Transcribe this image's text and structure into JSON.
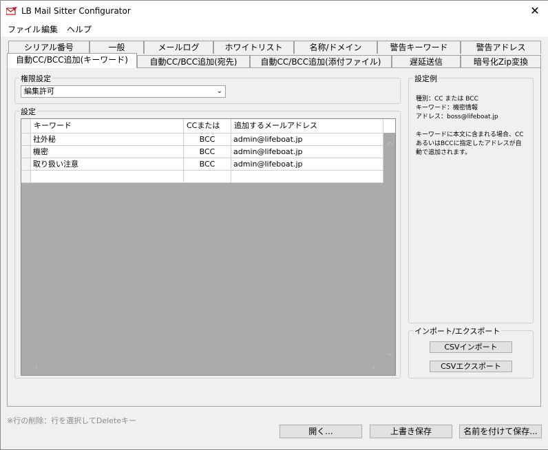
{
  "window": {
    "title": "LB Mail Sitter Configurator"
  },
  "menu": [
    "ファイル",
    "編集",
    "ヘルプ"
  ],
  "tabs_row1": [
    "シリアル番号",
    "一般",
    "メールログ",
    "ホワイトリスト",
    "名称/ドメイン",
    "警告キーワード",
    "警告アドレス"
  ],
  "tabs_row2": [
    "自動CC/BCC追加(キーワード)",
    "自動CC/BCC追加(宛先)",
    "自動CC/BCC追加(添付ファイル)",
    "遅延送信",
    "暗号化Zip変換"
  ],
  "permission": {
    "label": "権限設定",
    "value": "編集許可"
  },
  "settings": {
    "label": "設定",
    "columns": [
      "キーワード",
      "CCまたはBCC",
      "追加するメールアドレス"
    ],
    "rows": [
      [
        "社外秘",
        "BCC",
        "admin@lifeboat.jp"
      ],
      [
        "機密",
        "BCC",
        "admin@lifeboat.jp"
      ],
      [
        "取り扱い注意",
        "BCC",
        "admin@lifeboat.jp"
      ]
    ]
  },
  "example": {
    "label": "設定例",
    "line1": "種別：CC または BCC",
    "line2": "キーワード：機密情報",
    "line3": "アドレス：boss@lifeboat.jp",
    "line4": "キーワードに本文に含まれる場合、CCあるいはBCCに指定したアドレスが自動で追加されます。"
  },
  "import_export": {
    "label": "インポート/エクスポート",
    "import": "CSVインポート",
    "export": "CSVエクスポート"
  },
  "hint": "※行の削除：行を選択してDeleteキー",
  "buttons": {
    "open": "開く...",
    "save": "上書き保存",
    "save_as": "名前を付けて保存..."
  },
  "colors": {
    "accent_red": "#d0101a"
  }
}
